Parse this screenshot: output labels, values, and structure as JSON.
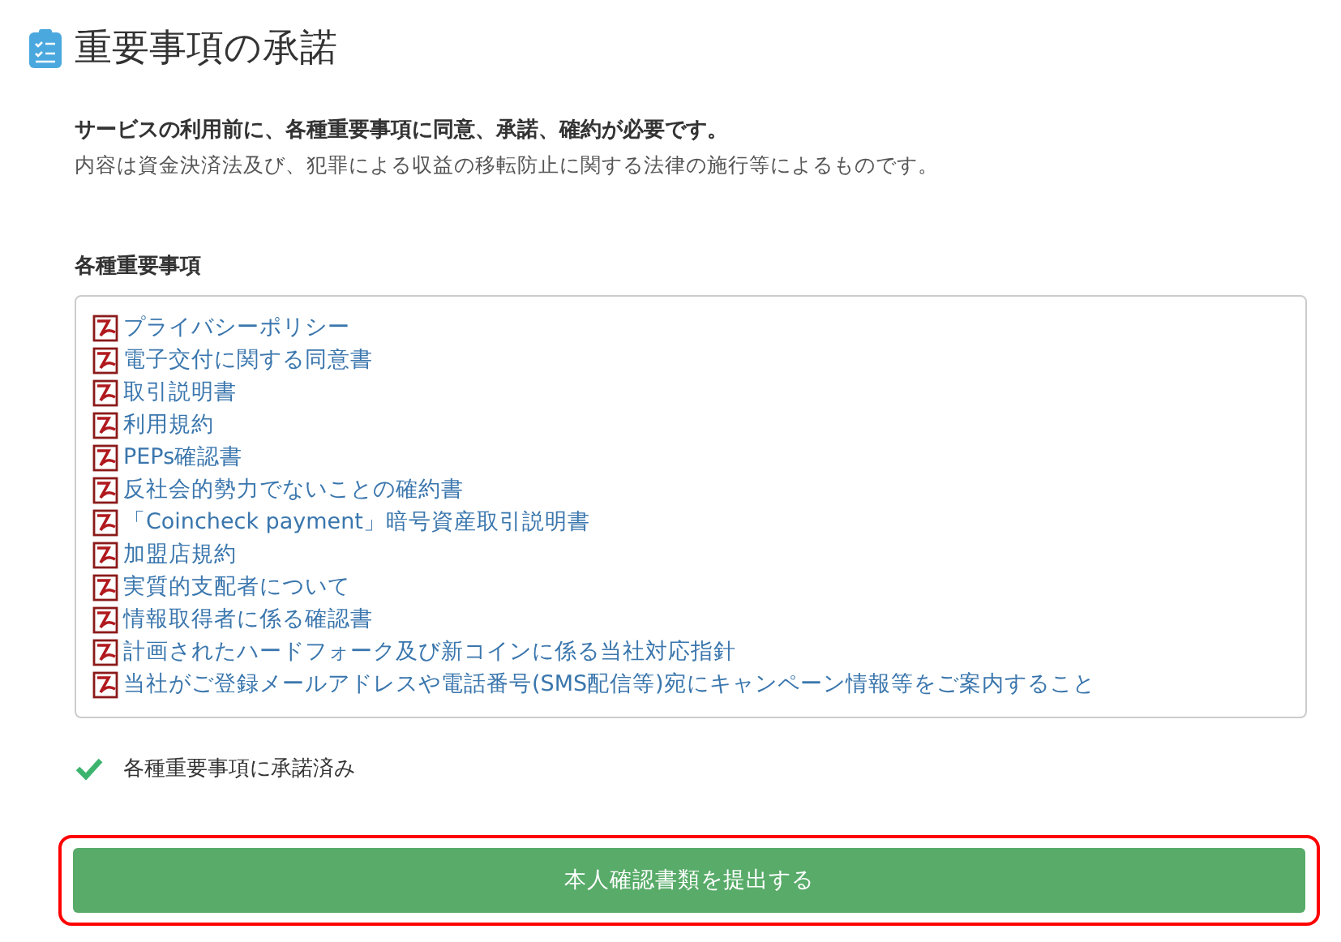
{
  "title": "重要事項の承諾",
  "intro": {
    "lead": "サービスの利用前に、各種重要事項に同意、承諾、確約が必要です。",
    "note": "内容は資金決済法及び、犯罪による収益の移転防止に関する法律の施行等によるものです。"
  },
  "documents": {
    "heading": "各種重要事項",
    "items": [
      {
        "label": "プライバシーポリシー"
      },
      {
        "label": "電子交付に関する同意書"
      },
      {
        "label": "取引説明書"
      },
      {
        "label": "利用規約"
      },
      {
        "label": "PEPs確認書"
      },
      {
        "label": "反社会的勢力でないことの確約書"
      },
      {
        "label": "「Coincheck payment」暗号資産取引説明書"
      },
      {
        "label": "加盟店規約"
      },
      {
        "label": "実質的支配者について"
      },
      {
        "label": "情報取得者に係る確認書"
      },
      {
        "label": "計画されたハードフォーク及び新コインに係る当社対応指針"
      },
      {
        "label": "当社がご登録メールアドレスや電話番号(SMS配信等)宛にキャンペーン情報等をご案内すること"
      }
    ]
  },
  "agreement": {
    "label": "各種重要事項に承諾済み",
    "checked": true
  },
  "submit": {
    "label": "本人確認書類を提出する",
    "highlighted": true
  }
}
